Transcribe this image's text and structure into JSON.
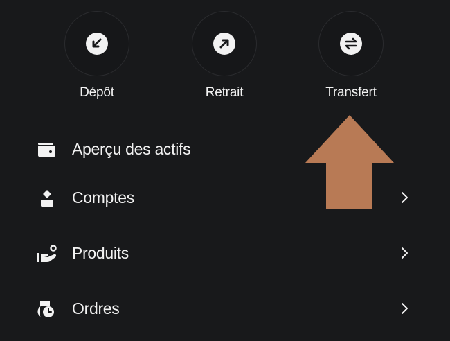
{
  "actions": [
    {
      "label": "Dépôt",
      "icon": "deposit-icon"
    },
    {
      "label": "Retrait",
      "icon": "withdraw-icon"
    },
    {
      "label": "Transfert",
      "icon": "transfer-icon"
    }
  ],
  "menu": [
    {
      "label": "Aperçu des actifs",
      "icon": "wallet-icon",
      "has_chevron": false
    },
    {
      "label": "Comptes",
      "icon": "accounts-icon",
      "has_chevron": true
    },
    {
      "label": "Produits",
      "icon": "products-icon",
      "has_chevron": true
    },
    {
      "label": "Ordres",
      "icon": "orders-icon",
      "has_chevron": true
    }
  ],
  "colors": {
    "background": "#18191b",
    "text": "#f2f2f2",
    "circle_border": "#2a2b2e",
    "arrow": "#b87a55"
  }
}
